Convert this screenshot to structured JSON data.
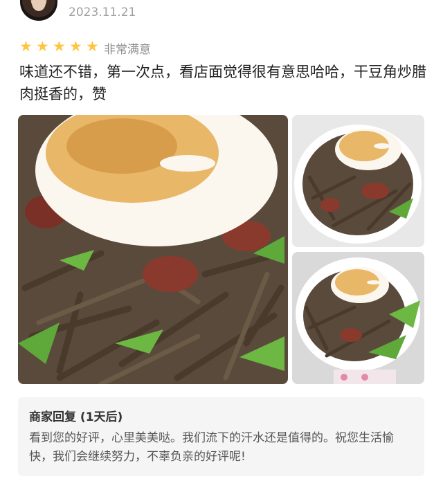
{
  "review": {
    "date": "2023.11.21",
    "rating": {
      "stars": 5,
      "label": "非常满意"
    },
    "text": "味道还不错，第一次点，看店面觉得很有意思哈哈，干豆角炒腊肉挺香的，赞"
  },
  "photos": [
    {
      "name": "fried-egg-dried-beans-bacon",
      "style": "close-up"
    },
    {
      "name": "fried-egg-dried-beans-bacon-bowl",
      "style": "bowl"
    },
    {
      "name": "fried-egg-dried-beans-bacon-bowl-2",
      "style": "bowl-with-peppers"
    }
  ],
  "merchant_reply": {
    "title": "商家回复 (1天后)",
    "text": "看到您的好评，心里美美哒。我们流下的汗水还是值得的。祝您生活愉快，我们会继续努力，不辜负亲的好评呢!"
  },
  "colors": {
    "star": "#ffc53d",
    "date": "#a0a0a0",
    "reply_bg": "#f5f5f5"
  }
}
